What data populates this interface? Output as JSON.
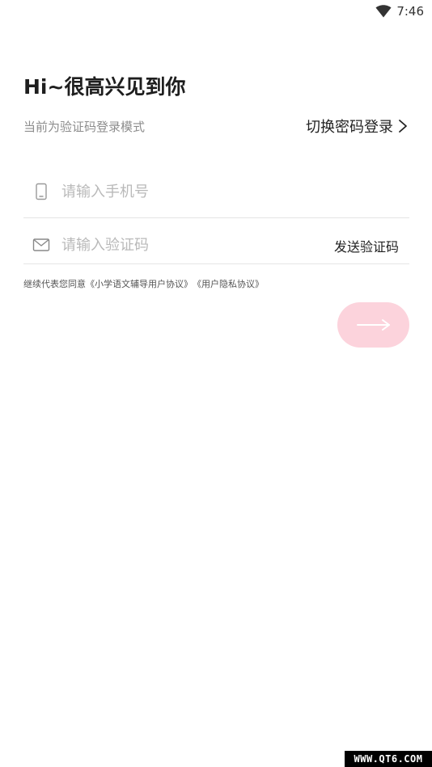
{
  "status_bar": {
    "time": "7:46",
    "wifi_icon": "wifi-icon"
  },
  "login": {
    "greeting": "Hi~很高兴见到你",
    "mode_text": "当前为验证码登录模式",
    "switch_label": "切换密码登录",
    "phone": {
      "icon": "phone-icon",
      "placeholder": "请输入手机号"
    },
    "code": {
      "icon": "mail-icon",
      "placeholder": "请输入验证码",
      "send_label": "发送验证码"
    },
    "agreement": {
      "prefix": "继续代表您同意",
      "user_agreement": "《小学语文辅导用户协议》",
      "privacy_agreement": "《用户隐私协议》"
    },
    "submit_icon": "arrow-right-icon",
    "submit_color": "#fcd3dc"
  },
  "watermark": "WWW.QT6.COM"
}
